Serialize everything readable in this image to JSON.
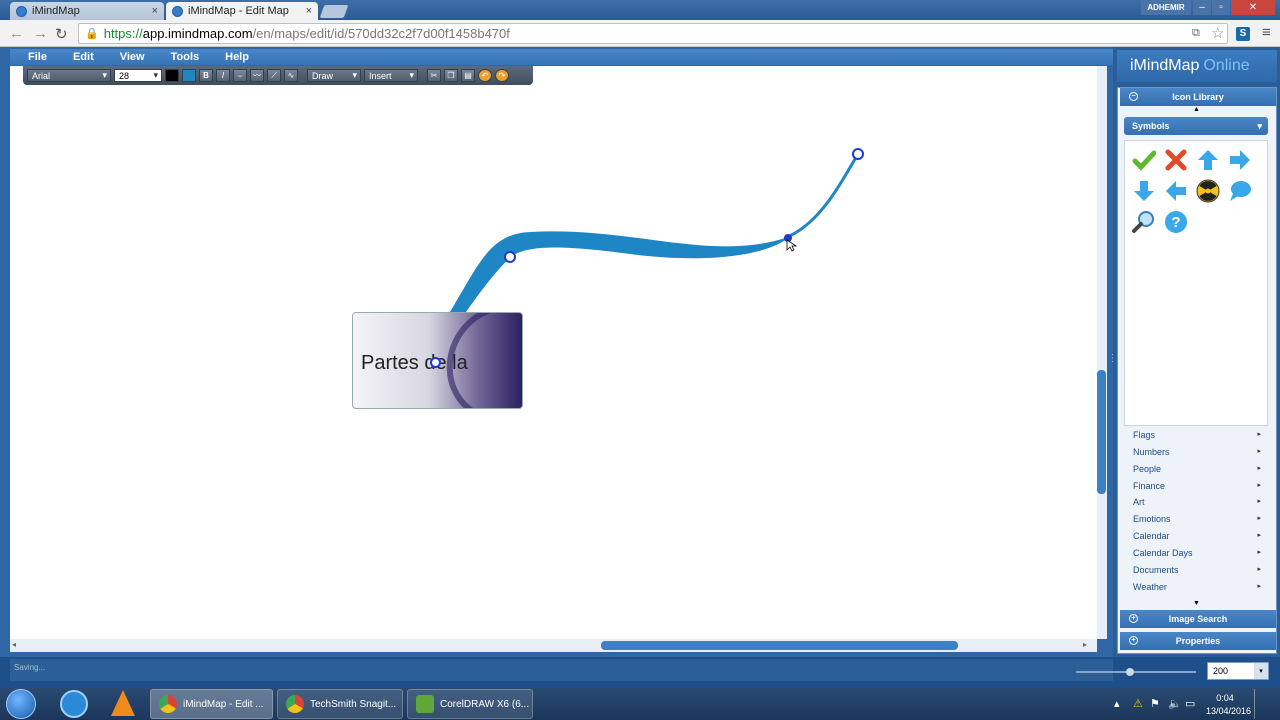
{
  "browser": {
    "tabs": [
      {
        "title": "iMindMap",
        "close": "×"
      },
      {
        "title": "iMindMap - Edit Map",
        "close": "×"
      }
    ],
    "user_badge": "ADHEMIR",
    "window_controls": {
      "minimize": "–",
      "maximize": "▫",
      "close": "✕"
    },
    "url": {
      "scheme": "https://",
      "host": "app.imindmap.com",
      "path": "/en/maps/edit/id/570dd32c2f7d00f1458b470f"
    }
  },
  "app": {
    "menu": [
      "File",
      "Edit",
      "View",
      "Tools",
      "Help"
    ],
    "toolbar": {
      "font": "Arial",
      "size": "28",
      "bold": "B",
      "italic": "I",
      "draw": "Draw",
      "insert": "Insert"
    },
    "central_idea": {
      "text": "Partes de la"
    },
    "status": "Saving...",
    "zoom": "200",
    "brand": {
      "name": "iMindMap",
      "suffix": "Online"
    }
  },
  "panel": {
    "icon_library_title": "Icon Library",
    "selected_category": "Symbols",
    "symbols": [
      "check-icon",
      "cross-icon",
      "arrow-up-icon",
      "arrow-right-icon",
      "arrow-down-icon",
      "arrow-left-icon",
      "radiation-icon",
      "speech-bubble-icon",
      "magnifier-icon",
      "question-icon"
    ],
    "categories": [
      "Flags",
      "Numbers",
      "People",
      "Finance",
      "Art",
      "Emotions",
      "Calendar",
      "Calendar Days",
      "Documents",
      "Weather"
    ],
    "image_search": "Image Search",
    "properties": "Properties"
  },
  "taskbar": {
    "items": [
      {
        "label": "iMindMap - Edit ..."
      },
      {
        "label": "TechSmith Snagit..."
      },
      {
        "label": "CorelDRAW X6 (6..."
      }
    ],
    "time": "0:04",
    "date": "13/04/2016"
  },
  "colors": {
    "branch": "#1f86c6",
    "accent": "#3574b8"
  }
}
